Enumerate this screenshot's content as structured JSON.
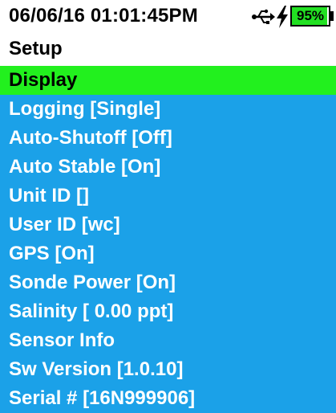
{
  "status": {
    "datetime": "06/06/16  01:01:45PM",
    "usb_icon": "usb-icon",
    "charging_icon": "lightning-icon",
    "battery_label": "95%",
    "battery_level": 0.95,
    "battery_color": "#22e022"
  },
  "header": {
    "title": "Setup"
  },
  "menu": {
    "background_color": "#1ba1e8",
    "selected_color": "#22f01e",
    "selected_index": 0,
    "items": [
      {
        "label": "Display"
      },
      {
        "label": "Logging [Single]"
      },
      {
        "label": "Auto-Shutoff [Off]"
      },
      {
        "label": "Auto Stable [On]"
      },
      {
        "label": "Unit ID []"
      },
      {
        "label": "User ID [wc]"
      },
      {
        "label": "GPS [On]"
      },
      {
        "label": "Sonde Power [On]"
      },
      {
        "label": "Salinity [ 0.00 ppt]"
      },
      {
        "label": "Sensor Info"
      },
      {
        "label": "Sw Version [1.0.10]"
      },
      {
        "label": "Serial # [16N999906]"
      }
    ]
  }
}
